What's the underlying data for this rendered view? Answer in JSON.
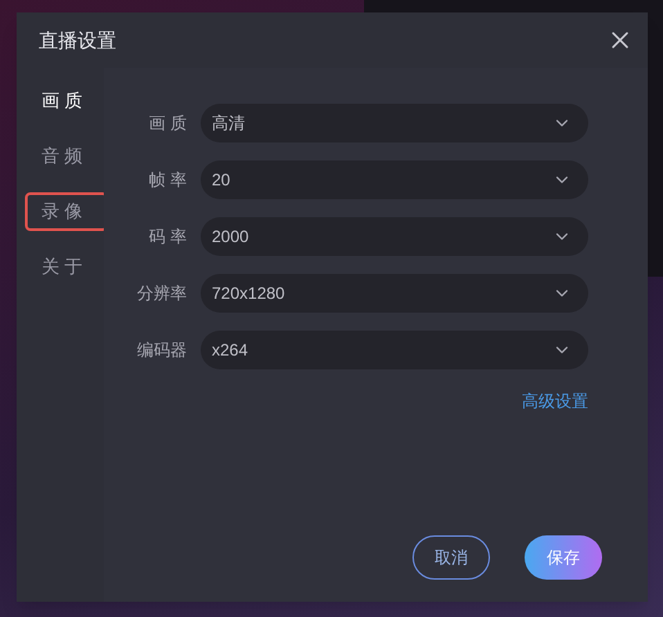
{
  "dialog": {
    "title": "直播设置"
  },
  "sidebar": {
    "items": [
      {
        "label": "画 质",
        "selected": true,
        "outlined": false
      },
      {
        "label": "音 频",
        "selected": false,
        "outlined": false
      },
      {
        "label": "录 像",
        "selected": false,
        "outlined": true
      },
      {
        "label": "关 于",
        "selected": false,
        "outlined": false
      }
    ]
  },
  "form": {
    "fields": [
      {
        "label": "画 质",
        "value": "高清"
      },
      {
        "label": "帧 率",
        "value": "20"
      },
      {
        "label": "码 率",
        "value": "2000"
      },
      {
        "label": "分辨率",
        "value": "720x1280"
      },
      {
        "label": "编码器",
        "value": "x264"
      }
    ]
  },
  "advanced_link": "高级设置",
  "buttons": [
    {
      "label": "取消",
      "kind": "secondary"
    },
    {
      "label": "保存",
      "kind": "primary"
    }
  ]
}
